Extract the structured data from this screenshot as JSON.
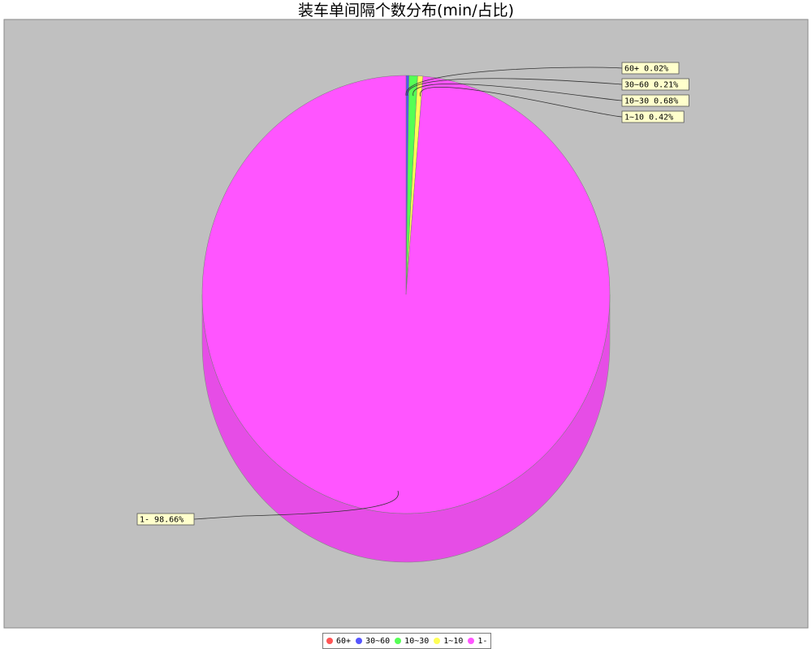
{
  "chart_data": {
    "type": "pie",
    "title": "装车单间隔个数分布(min/占比)",
    "plot_background": "#c0c0c0",
    "label_background": "#ffffcc",
    "slices": [
      {
        "name": "60+",
        "percent": 0.02,
        "label": "60+  0.02%",
        "color": "#ff5555"
      },
      {
        "name": "30~60",
        "percent": 0.21,
        "label": "30~60  0.21%",
        "color": "#5555ff"
      },
      {
        "name": "10~30",
        "percent": 0.68,
        "label": "10~30  0.68%",
        "color": "#55ff55"
      },
      {
        "name": "1~10",
        "percent": 0.42,
        "label": "1~10  0.42%",
        "color": "#ffff55"
      },
      {
        "name": "1-",
        "percent": 98.66,
        "label": "1-  98.66%",
        "color": "#ff55ff"
      }
    ],
    "legend": {
      "position": "bottom",
      "entries": [
        "60+",
        "30~60",
        "10~30",
        "1~10",
        "1-"
      ]
    }
  }
}
